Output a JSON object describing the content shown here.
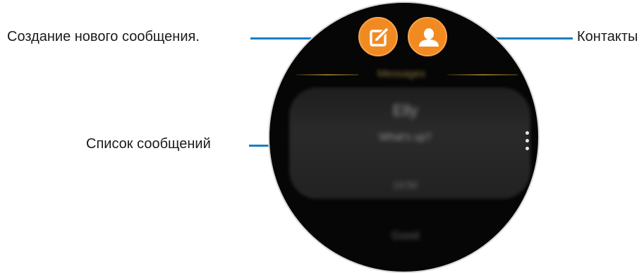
{
  "callouts": {
    "compose": "Создание нового сообщения.",
    "contacts": "Контакты",
    "message_list": "Список сообщений"
  },
  "screen": {
    "header": "Messages",
    "items": [
      "Elly",
      "What's up?",
      "14:50",
      "Good"
    ]
  },
  "icons": {
    "compose": "compose-icon",
    "contacts": "contacts-icon",
    "more": "more-options-icon"
  },
  "colors": {
    "accent": "#f28a22",
    "leader_line": "#1a7fc1",
    "header_line": "#8a6c2c"
  }
}
